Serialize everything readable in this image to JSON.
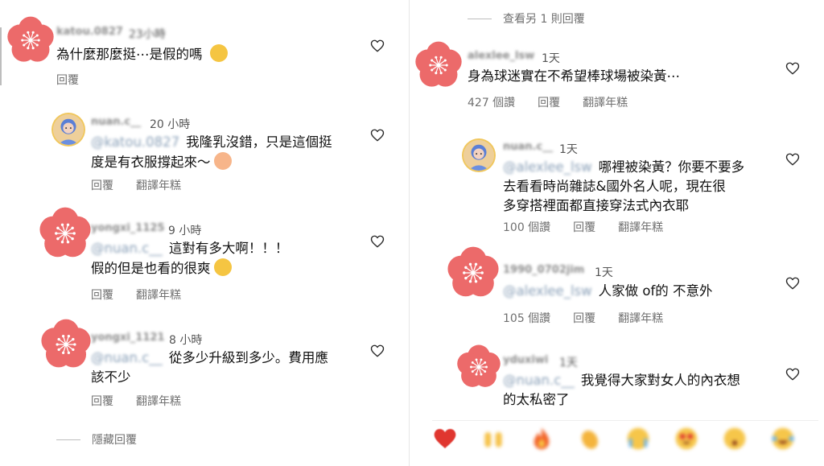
{
  "left": {
    "comments": [
      {
        "username": "katou.0827",
        "time": "23小時",
        "text_lines": [
          "為什麼那麼挺⋯是假的嗎"
        ],
        "actions": [
          "回覆"
        ]
      },
      {
        "username": "nuan.c__",
        "time": "20 小時",
        "mention": "@katou.0827",
        "text_lines": [
          "我隆乳沒錯，只是這個挺",
          "度是有衣服撐起來～"
        ],
        "actions": [
          "回覆",
          "翻譯年糕"
        ]
      },
      {
        "username": "yongxi_1125",
        "time": "9 小時",
        "mention": "@nuan.c__",
        "text_lines": [
          "這對有多大啊！！！",
          "假的但是也看的很爽"
        ],
        "actions": [
          "回覆",
          "翻譯年糕"
        ]
      },
      {
        "username": "yongxi_1121",
        "time": "8 小時",
        "mention": "@nuan.c__",
        "text_lines": [
          "從多少升級到多少。費用應",
          "該不少"
        ],
        "actions": [
          "回覆",
          "翻譯年糕"
        ]
      }
    ],
    "hide_replies": "隱藏回覆"
  },
  "right": {
    "view_more": "查看另 1 則回覆",
    "comments": [
      {
        "username": "alexlee_lsw",
        "time": "1天",
        "text_lines": [
          "身為球迷實在不希望棒球場被染黃⋯"
        ],
        "actions": [
          "427 個讚",
          "回覆",
          "翻譯年糕"
        ]
      },
      {
        "username": "nuan.c__",
        "time": "1天",
        "mention": "@alexlee_lsw",
        "text_lines": [
          "哪裡被染黃？你要不要多",
          "去看看時尚雜誌&國外名人呢，現在很",
          "多穿搭裡面都直接穿法式內衣耶"
        ],
        "actions": [
          "100 個讚",
          "回覆",
          "翻譯年糕"
        ]
      },
      {
        "username": "1990_0702jim",
        "time": "1天",
        "mention": "@alexlee_lsw",
        "text_lines": [
          "人家做 of的 不意外"
        ],
        "actions": [
          "105 個讚",
          "回覆",
          "翻譯年糕"
        ]
      },
      {
        "username": "yduxiwi",
        "time": "1天",
        "mention": "@nuan.c__",
        "text_lines": [
          "我覺得大家對女人的內衣想",
          "的太私密了"
        ],
        "actions": []
      }
    ],
    "reactions": [
      "red-heart",
      "raising-hands",
      "fire",
      "clapping-hands",
      "crying-face",
      "heart-eyes-face",
      "surprised-face",
      "laughing-tears-face"
    ]
  },
  "colors": {
    "blossom": "#ec6a6a",
    "heart_outline": "#262626",
    "muted": "#707070"
  }
}
